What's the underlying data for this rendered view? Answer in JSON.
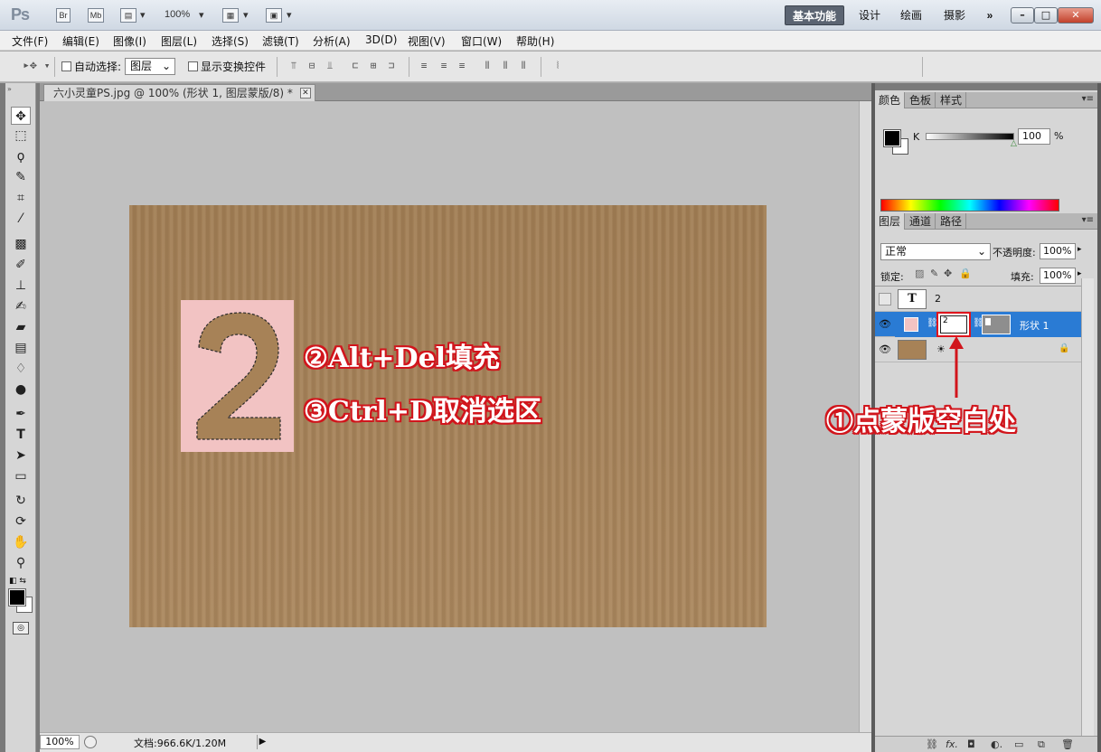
{
  "titlebar": {
    "logo": "Ps",
    "bridge": "Br",
    "minibridge": "Mb",
    "zoom": "100%",
    "workspaces": [
      "基本功能",
      "设计",
      "绘画",
      "摄影"
    ],
    "more": "»",
    "win_min": "–",
    "win_max": "□",
    "win_close": "✕"
  },
  "menu": [
    "文件(F)",
    "编辑(E)",
    "图像(I)",
    "图层(L)",
    "选择(S)",
    "滤镜(T)",
    "分析(A)",
    "3D(D)",
    "视图(V)",
    "窗口(W)",
    "帮助(H)"
  ],
  "options": {
    "auto_select_label": "自动选择:",
    "auto_select_target": "图层",
    "show_transform_label": "显示变换控件"
  },
  "document": {
    "tab_title": "六小灵童PS.jpg @ 100% (形状 1, 图层蒙版/8) *",
    "close": "✕",
    "big_glyph": "2"
  },
  "annotations": {
    "step2": "②Alt+Del填充",
    "step3": "③Ctrl+D取消选区",
    "step1": "①点蒙版空白处"
  },
  "status": {
    "zoom": "100%",
    "doc_info": "文档:966.6K/1.20M",
    "arrow": "▶"
  },
  "color_panel": {
    "tabs": [
      "颜色",
      "色板",
      "样式"
    ],
    "channel": "K",
    "value": "100",
    "unit": "%"
  },
  "layers_panel": {
    "tabs": [
      "图层",
      "通道",
      "路径"
    ],
    "blend_mode": "正常",
    "opacity_label": "不透明度:",
    "opacity_value": "100%",
    "lock_label": "锁定:",
    "fill_label": "填充:",
    "fill_value": "100%",
    "layers": [
      {
        "name": "2",
        "thumb_text": "T",
        "mask_text": ""
      },
      {
        "name": "形状 1",
        "thumb_text": "",
        "mask_text": "2"
      },
      {
        "name": "",
        "thumb_text": "",
        "mask_text": ""
      }
    ]
  },
  "colors": {
    "accent": "#2a7bd4",
    "annotation_red": "#d1151c",
    "shape_pink": "#f2c3c3",
    "cardboard": "#a78257"
  }
}
